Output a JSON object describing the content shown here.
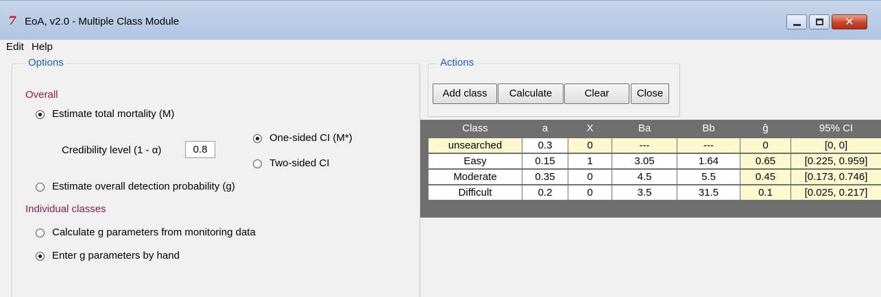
{
  "window": {
    "title": "EoA, v2.0 - Multiple Class Module",
    "app_icon": "tk-feather-icon",
    "min_glyph": "minimize-icon",
    "max_glyph": "maximize-icon",
    "close_glyph": "✕"
  },
  "menu": {
    "edit": "Edit",
    "help": "Help"
  },
  "options": {
    "legend": "Options",
    "overall_title": "Overall",
    "estimate_total": "Estimate total mortality (M)",
    "credibility_label": "Credibility level (1 - α)",
    "credibility_value": "0.8",
    "one_sided": "One-sided CI (M*)",
    "two_sided": "Two-sided CI",
    "estimate_g": "Estimate overall detection probability (g)",
    "individual_title": "Individual classes",
    "calc_g": "Calculate g parameters from monitoring data",
    "enter_g": "Enter g parameters by hand"
  },
  "actions": {
    "legend": "Actions",
    "add_class": "Add class",
    "calculate": "Calculate",
    "clear": "Clear",
    "close": "Close"
  },
  "table": {
    "headers": [
      "Class",
      "a",
      "X",
      "Ba",
      "Bb",
      "ĝ",
      "95% CI"
    ],
    "rows": [
      [
        "unsearched",
        "0.3",
        "0",
        "---",
        "---",
        "0",
        "[0, 0]"
      ],
      [
        "Easy",
        "0.15",
        "1",
        "3.05",
        "1.64",
        "0.65",
        "[0.225, 0.959]"
      ],
      [
        "Moderate",
        "0.35",
        "0",
        "4.5",
        "5.5",
        "0.45",
        "[0.173, 0.746]"
      ],
      [
        "Difficult",
        "0.2",
        "0",
        "3.5",
        "31.5",
        "0.1",
        "[0.025, 0.217]"
      ]
    ]
  }
}
